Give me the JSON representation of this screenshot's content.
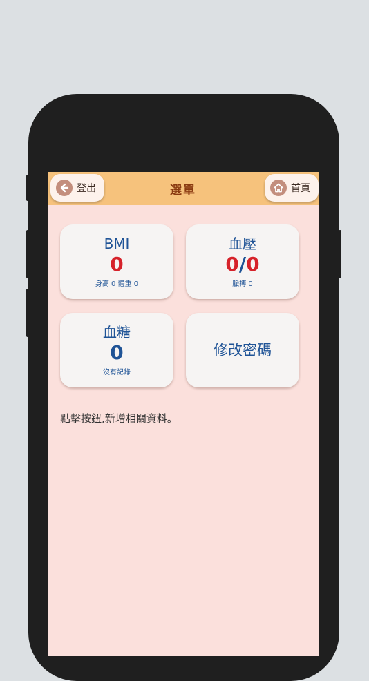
{
  "header": {
    "title": "選單",
    "logout_label": "登出",
    "home_label": "首頁",
    "logout_icon": "arrow-left-icon",
    "home_icon": "home-icon"
  },
  "cards": {
    "bmi": {
      "title": "BMI",
      "value": "0",
      "sub": "身高 0 體重 0"
    },
    "blood_pressure": {
      "title": "血壓",
      "value_sys": "0",
      "separator": "/",
      "value_dia": "0",
      "sub": "脈搏 0"
    },
    "blood_sugar": {
      "title": "血糖",
      "value": "0",
      "sub": "沒有記錄"
    },
    "change_password": {
      "title": "修改密碼"
    }
  },
  "note": "點擊按鈕,新增相關資料。",
  "colors": {
    "header_bg": "#f6c27c",
    "screen_bg": "#fbe0dc",
    "value_red": "#d6222a",
    "text_blue": "#1f5396"
  }
}
